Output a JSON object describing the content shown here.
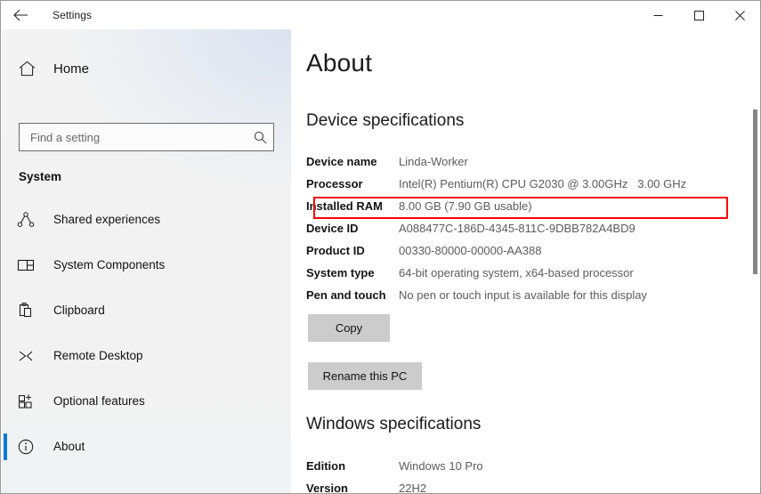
{
  "titlebar": {
    "back_label": "back-arrow",
    "app_title": "Settings",
    "minimize_label": "Minimize",
    "maximize_label": "Maximize",
    "close_label": "Close"
  },
  "sidebar": {
    "home_label": "Home",
    "search": {
      "placeholder": "Find a setting",
      "value": ""
    },
    "group_title": "System",
    "items": [
      {
        "label": "Shared experiences",
        "icon": "shared-experiences-icon",
        "selected": false
      },
      {
        "label": "System Components",
        "icon": "system-components-icon",
        "selected": false
      },
      {
        "label": "Clipboard",
        "icon": "clipboard-icon",
        "selected": false
      },
      {
        "label": "Remote Desktop",
        "icon": "remote-desktop-icon",
        "selected": false
      },
      {
        "label": "Optional features",
        "icon": "optional-features-icon",
        "selected": false
      },
      {
        "label": "About",
        "icon": "info-circle-icon",
        "selected": true
      }
    ],
    "accent_color": "#0078d7"
  },
  "main": {
    "page_title": "About",
    "device_specifications": {
      "heading": "Device specifications",
      "rows": [
        {
          "key": "Device name",
          "value": "Linda-Worker"
        },
        {
          "key": "Processor",
          "value": "Intel(R) Pentium(R) CPU G2030 @ 3.00GHz   3.00 GHz"
        },
        {
          "key": "Installed RAM",
          "value": "8.00 GB (7.90 GB usable)"
        },
        {
          "key": "Device ID",
          "value": "A088477C-186D-4345-811C-9DBB782A4BD9"
        },
        {
          "key": "Product ID",
          "value": "00330-80000-00000-AA388"
        },
        {
          "key": "System type",
          "value": "64-bit operating system, x64-based processor"
        },
        {
          "key": "Pen and touch",
          "value": "No pen or touch input is available for this display"
        }
      ],
      "highlight": {
        "row_index": 1,
        "color": "#ff0000"
      }
    },
    "copy_button": "Copy",
    "rename_button": "Rename this PC",
    "windows_specifications": {
      "heading": "Windows specifications",
      "rows": [
        {
          "key": "Edition",
          "value": "Windows 10 Pro"
        },
        {
          "key": "Version",
          "value": "22H2"
        }
      ]
    }
  }
}
